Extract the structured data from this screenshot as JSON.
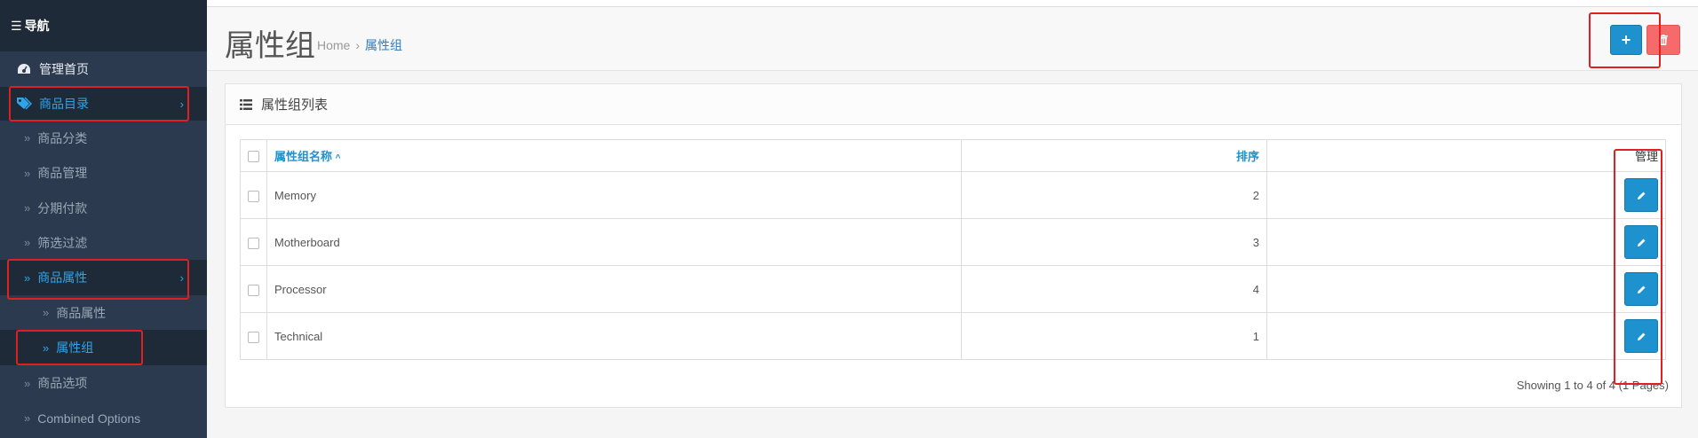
{
  "sidebar": {
    "header": "导航",
    "items": [
      {
        "label": "管理首页"
      },
      {
        "label": "商品目录"
      },
      {
        "label": "商品分类"
      },
      {
        "label": "商品管理"
      },
      {
        "label": "分期付款"
      },
      {
        "label": "筛选过滤"
      },
      {
        "label": "商品属性"
      },
      {
        "label": "商品属性"
      },
      {
        "label": "属性组"
      },
      {
        "label": "商品选项"
      },
      {
        "label": "Combined Options"
      }
    ]
  },
  "header": {
    "title": "属性组",
    "breadcrumb": {
      "home": "Home",
      "sep": "›",
      "current": "属性组"
    }
  },
  "panel": {
    "title": "属性组列表",
    "columns": {
      "name": "属性组名称",
      "sort": "排序",
      "action": "管理"
    },
    "rows": [
      {
        "name": "Memory",
        "sort": "2"
      },
      {
        "name": "Motherboard",
        "sort": "3"
      },
      {
        "name": "Processor",
        "sort": "4"
      },
      {
        "name": "Technical",
        "sort": "1"
      }
    ],
    "pagination": "Showing 1 to 4 of 4 (1 Pages)"
  },
  "colors": {
    "primary": "#1e91cf",
    "danger": "#f56b6b",
    "sidebar": "#2b3a4e",
    "highlight": "#e02020"
  }
}
